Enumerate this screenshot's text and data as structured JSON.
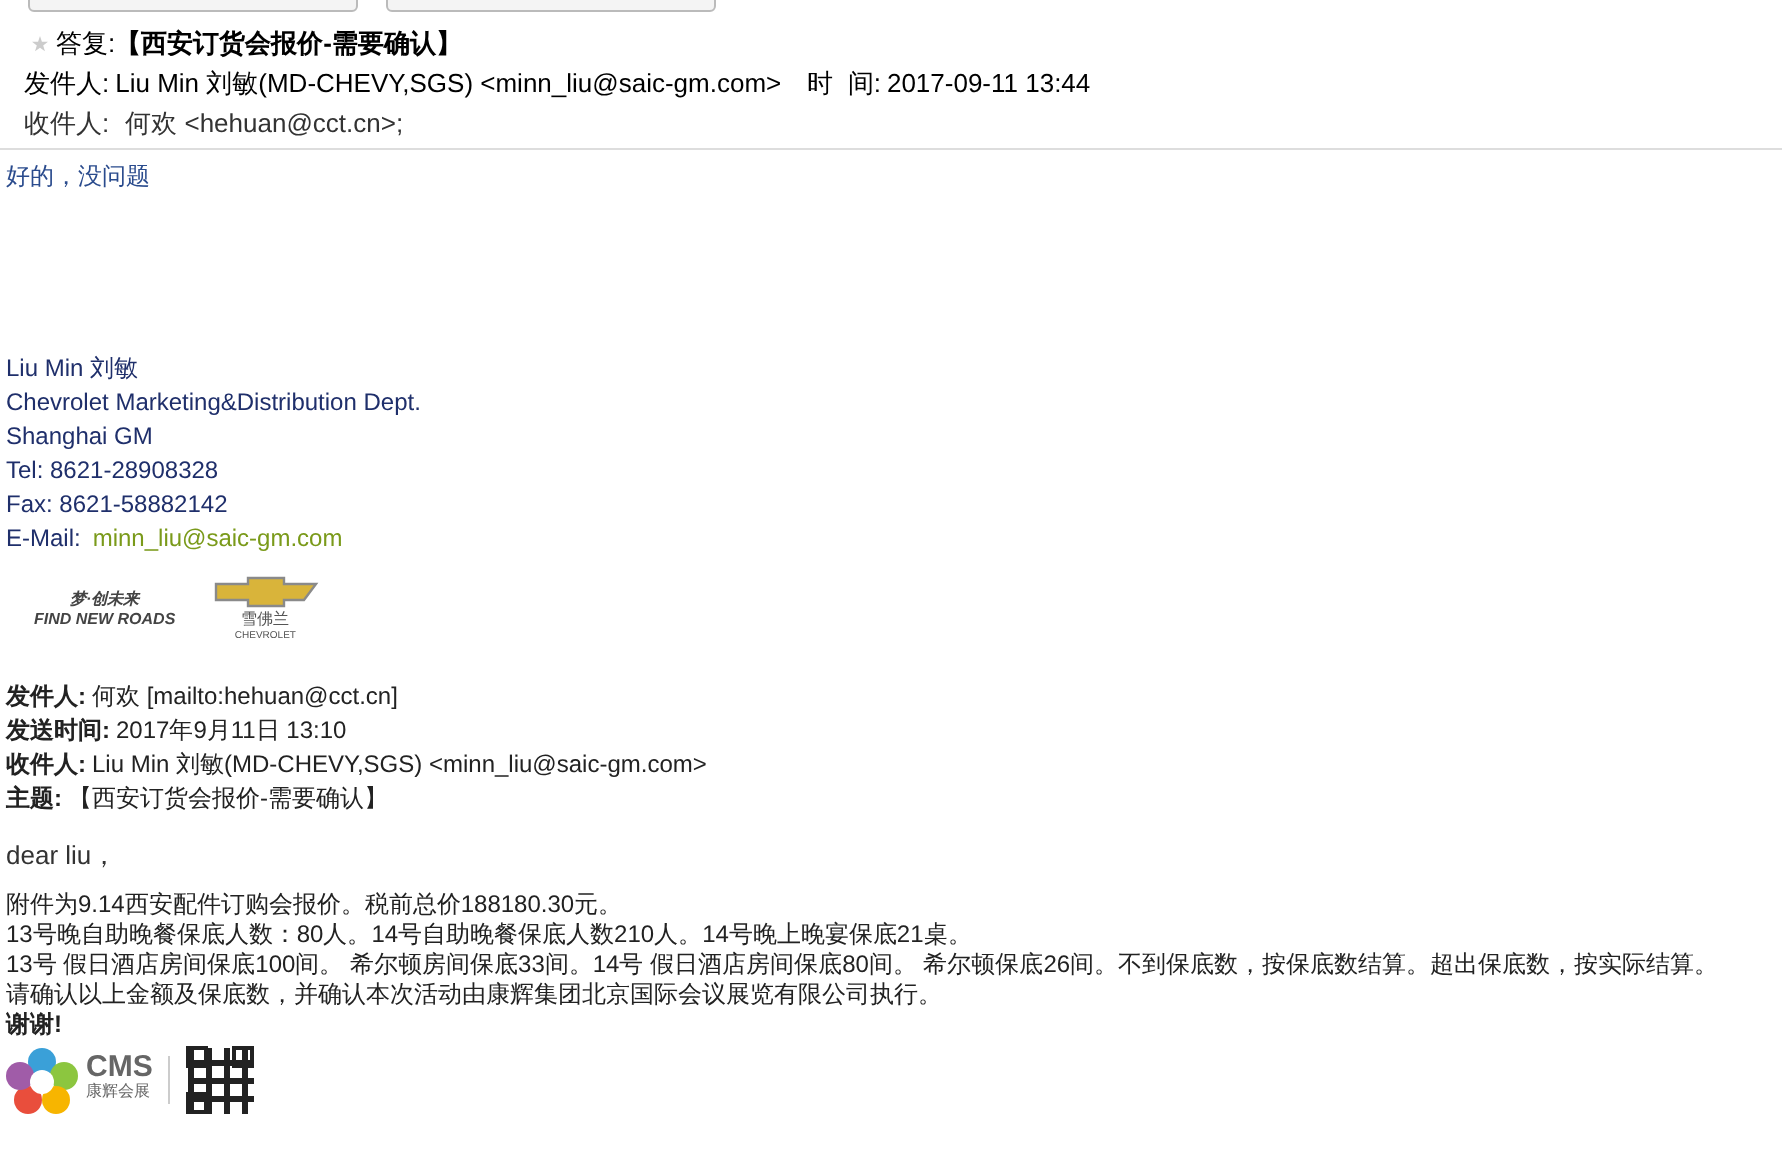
{
  "header": {
    "tabs": [
      {
        "kind": "tab"
      },
      {
        "kind": "tab"
      }
    ],
    "subject_label": "答复:",
    "subject": "【西安订货会报价-需要确认】",
    "from_label": "发件人:",
    "from": "Liu Min 刘敏(MD-CHEVY,SGS) <minn_liu@saic-gm.com>",
    "time_label": "时  间:",
    "time": "2017-09-11 13:44",
    "to_label": "收件人:",
    "to": "何欢 <hehuan@cct.cn>;"
  },
  "reply": "好的，没问题",
  "signature": {
    "lines": [
      "Liu Min 刘敏",
      "Chevrolet Marketing&Distribution Dept.",
      "Shanghai GM",
      "Tel: 8621-28908328",
      "Fax: 8621-58882142"
    ],
    "email_label": "E-Mail:",
    "email": "minn_liu@saic-gm.com",
    "logo_left": [
      "梦·创未来",
      "FIND NEW ROADS"
    ],
    "logo_right": [
      "雪佛兰",
      "CHEVROLET"
    ]
  },
  "quoted_header": [
    {
      "label": "发件人:",
      "value": "何欢 [mailto:hehuan@cct.cn]"
    },
    {
      "label": "发送时间:",
      "value": "2017年9月11日 13:10"
    },
    {
      "label": "收件人:",
      "value": "Liu Min 刘敏(MD-CHEVY,SGS) <minn_liu@saic-gm.com>"
    },
    {
      "label": "主题:",
      "value": "【西安订货会报价-需要确认】"
    }
  ],
  "greeting": "dear liu，",
  "body": [
    "附件为9.14西安配件订购会报价。税前总价188180.30元。",
    "13号晚自助晚餐保底人数：80人。14号自助晚餐保底人数210人。14号晚上晚宴保底21桌。",
    "13号 假日酒店房间保底100间。 希尔顿房间保底33间。14号 假日酒店房间保底80间。 希尔顿保底26间。不到保底数，按保底数结算。超出保底数，按实际结算。",
    "请确认以上金额及保底数，并确认本次活动由康辉集团北京国际会议展览有限公司执行。"
  ],
  "thanks": "谢谢!",
  "footer_logo": {
    "name": "CMS",
    "sub": "康辉会展"
  }
}
